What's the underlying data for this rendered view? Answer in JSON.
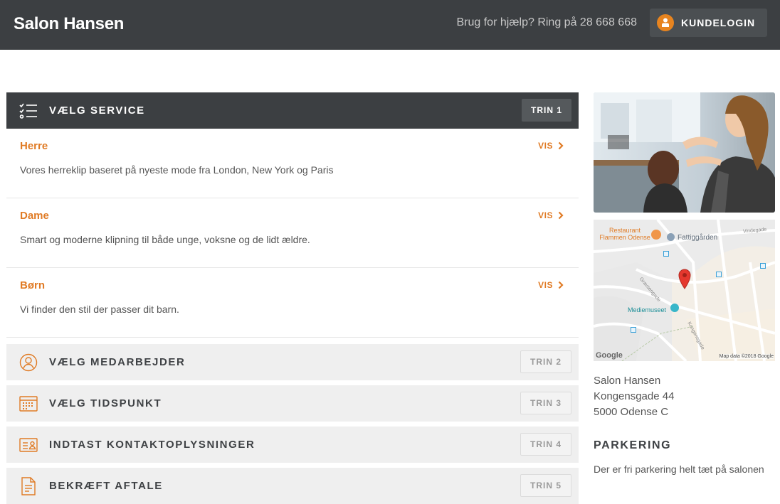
{
  "header": {
    "brand": "Salon Hansen",
    "help_text": "Brug for hjælp? Ring på 28 668 668",
    "login_label": "KUNDELOGIN"
  },
  "steps": {
    "service": {
      "title": "VÆLG SERVICE",
      "badge": "TRIN 1"
    },
    "staff": {
      "title": "VÆLG MEDARBEJDER",
      "badge": "TRIN 2"
    },
    "time": {
      "title": "VÆLG TIDSPUNKT",
      "badge": "TRIN 3"
    },
    "contact": {
      "title": "INDTAST KONTAKTOPLYSNINGER",
      "badge": "TRIN 4"
    },
    "confirm": {
      "title": "BEKRÆFT AFTALE",
      "badge": "TRIN 5"
    }
  },
  "services": [
    {
      "name": "Herre",
      "description": "Vores herreklip baseret på nyeste mode fra London, New York og Paris",
      "action": "VIS"
    },
    {
      "name": "Dame",
      "description": "Smart og moderne klipning til både unge, voksne og de lidt ældre.",
      "action": "VIS"
    },
    {
      "name": "Børn",
      "description": "Vi finder den stil der passer dit barn.",
      "action": "VIS"
    }
  ],
  "sidebar": {
    "map": {
      "labels": {
        "restaurant": "Restaurant Flammen Odense",
        "poi1": "Fattiggården",
        "poi2": "Mediemuseet",
        "street1": "Vindegade",
        "street2": "Gravsengade",
        "street3": "Kongensgade",
        "logo": "Google",
        "attribution": "Map data ©2018 Google"
      }
    },
    "address": {
      "name": "Salon Hansen",
      "street": "Kongensgade 44",
      "city": "5000 Odense C"
    },
    "parking": {
      "title": "PARKERING",
      "text": "Der er fri parkering helt tæt på salonen"
    }
  },
  "colors": {
    "accent": "#e07b25",
    "dark": "#3c3f42"
  }
}
